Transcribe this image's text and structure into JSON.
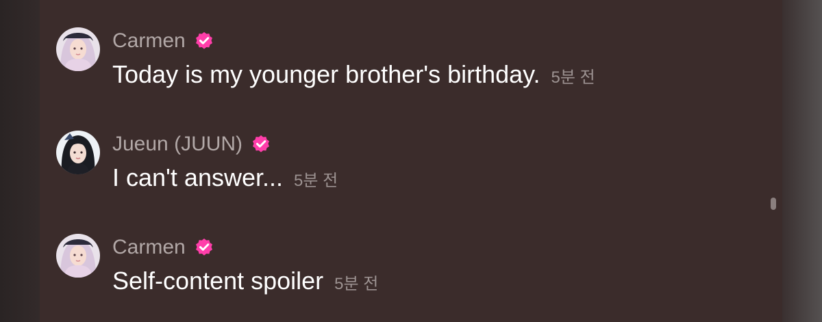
{
  "messages": [
    {
      "author": "Carmen",
      "verified": true,
      "text": "Today is my younger brother's birthday.",
      "time": "5분 전",
      "avatar": "carmen-avatar"
    },
    {
      "author": "Jueun (JUUN)",
      "verified": true,
      "text": "I can't answer...",
      "time": "5분 전",
      "avatar": "jueun-avatar"
    },
    {
      "author": "Carmen",
      "verified": true,
      "text": "Self-content spoiler",
      "time": "5분 전",
      "avatar": "carmen-avatar"
    }
  ],
  "colors": {
    "panel_bg": "#3b2c2b",
    "verified_badge": "#ff3eaa",
    "author_name": "#b2a8a7",
    "message_text": "#ffffff",
    "timestamp": "#9c9291"
  }
}
